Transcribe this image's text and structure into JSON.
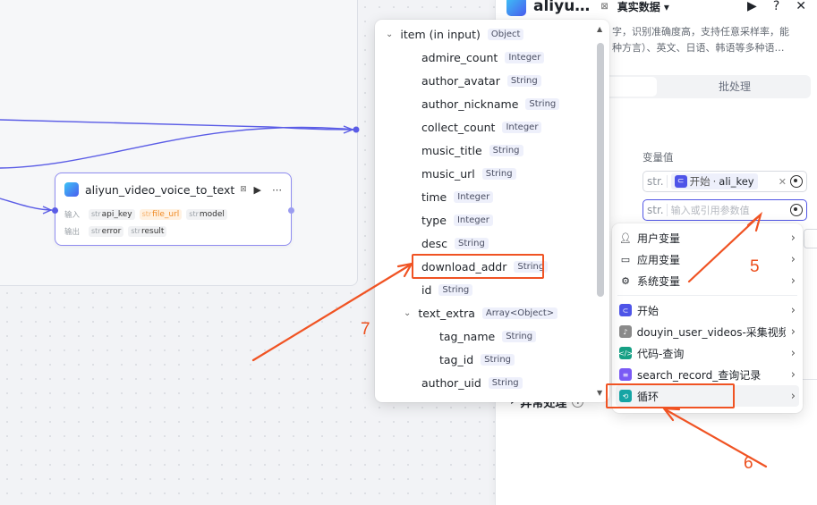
{
  "node": {
    "title": "aliyun_video_voice_to_text",
    "input_label": "输入",
    "output_label": "输出",
    "inputs": [
      {
        "type": "str",
        "name": "api_key",
        "warn": false
      },
      {
        "type": "str",
        "name": "file_url",
        "warn": true
      },
      {
        "type": "str",
        "name": "model",
        "warn": false
      }
    ],
    "outputs": [
      {
        "type": "str",
        "name": "error"
      },
      {
        "type": "str",
        "name": "result"
      }
    ]
  },
  "panel": {
    "title": "aliyu…",
    "mode": "真实数据",
    "description_line1": "字，识别准确度高，支持任意采样率，能",
    "description_line2": "种方言）、英文、日语、韩语等多种语…",
    "tab_batch": "批处理",
    "value_label": "变量值",
    "field1_type": "str.",
    "field1_ref_source": "开始",
    "field1_ref_sep": "·",
    "field1_ref_name": "ali_key",
    "field2_type": "str.",
    "field2_placeholder": "输入或引用参数值",
    "exception_label": "异常处理"
  },
  "var_menu": {
    "items": [
      {
        "icon": "user-icon",
        "label": "用户变量"
      },
      {
        "icon": "folder-icon",
        "label": "应用变量"
      },
      {
        "icon": "gear-icon",
        "label": "系统变量"
      },
      {
        "icon": "start-icon",
        "label": "开始",
        "color": "#4e54e8"
      },
      {
        "icon": "douyin-icon",
        "label": "douyin_user_videos-采集视频",
        "color": "#8a8a8a"
      },
      {
        "icon": "code-icon",
        "label": "代码-查询",
        "color": "#16a085"
      },
      {
        "icon": "database-icon",
        "label": "search_record_查询记录",
        "color": "#7a5af5"
      },
      {
        "icon": "loop-icon",
        "label": "循环",
        "color": "#16a5a5"
      }
    ]
  },
  "tree": {
    "root": {
      "name": "item (in input)",
      "type": "Object"
    },
    "fields": [
      {
        "name": "admire_count",
        "type": "Integer"
      },
      {
        "name": "author_avatar",
        "type": "String"
      },
      {
        "name": "author_nickname",
        "type": "String"
      },
      {
        "name": "collect_count",
        "type": "Integer"
      },
      {
        "name": "music_title",
        "type": "String"
      },
      {
        "name": "music_url",
        "type": "String"
      },
      {
        "name": "time",
        "type": "Integer"
      },
      {
        "name": "type",
        "type": "Integer"
      },
      {
        "name": "desc",
        "type": "String"
      },
      {
        "name": "download_addr",
        "type": "String"
      },
      {
        "name": "id",
        "type": "String"
      },
      {
        "name": "text_extra",
        "type": "Array<Object>"
      },
      {
        "name": "tag_name",
        "type": "String"
      },
      {
        "name": "tag_id",
        "type": "String"
      },
      {
        "name": "author_uid",
        "type": "String"
      }
    ]
  },
  "annotations": {
    "n5": "5",
    "n6": "6",
    "n7": "7"
  },
  "colors": {
    "accent": "#5156e6",
    "annotation": "#f05323"
  }
}
